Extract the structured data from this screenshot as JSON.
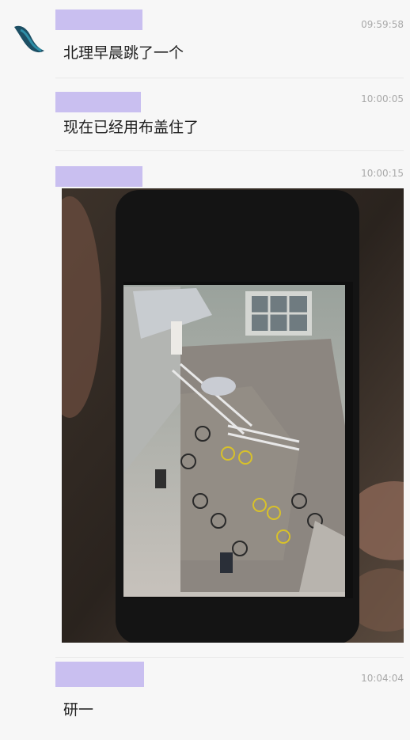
{
  "messages": [
    {
      "time": "09:59:58",
      "text": "北理早晨跳了一个"
    },
    {
      "time": "10:00:05",
      "text": "现在已经用布盖住了"
    },
    {
      "time": "10:00:15",
      "text": ""
    },
    {
      "time": "10:04:04",
      "text": "研一"
    }
  ],
  "colors": {
    "background": "#f7f7f7",
    "name_redaction": "#c9bff0",
    "time_text": "#a9a9a9",
    "message_text": "#1f1f1f"
  }
}
